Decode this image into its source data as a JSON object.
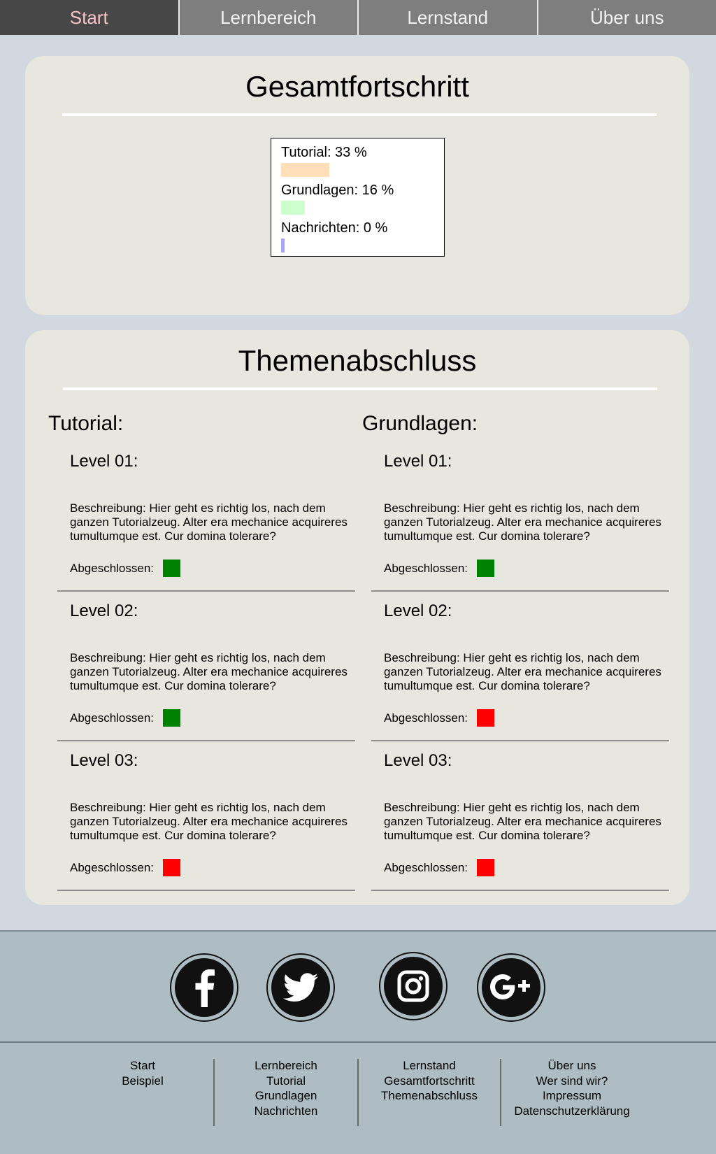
{
  "nav": [
    {
      "label": "Start",
      "active": true
    },
    {
      "label": "Lernbereich",
      "active": false
    },
    {
      "label": "Lernstand",
      "active": false
    },
    {
      "label": "Über uns",
      "active": false
    }
  ],
  "overall": {
    "title": "Gesamtfortschritt",
    "items": [
      {
        "label": "Tutorial: 33 %",
        "percent": 33,
        "color": "#ffdfb8"
      },
      {
        "label": "Grundlagen: 16 %",
        "percent": 16,
        "color": "#ccffcc"
      },
      {
        "label": "Nachrichten: 0 %",
        "percent": 0,
        "color": "#a8a8ee"
      }
    ]
  },
  "topics": {
    "title": "Themenabschluss",
    "columns": [
      {
        "title": "Tutorial:",
        "levels": [
          {
            "title": "Level 01:",
            "desc": "Beschreibung: Hier geht es richtig los, nach dem ganzen Tutorialzeug. Alter era mechanice acquireres tumultumque est. Cur domina tolerare?",
            "done_label": "Abgeschlossen:",
            "done": true
          },
          {
            "title": "Level 02:",
            "desc": "Beschreibung: Hier geht es richtig los, nach dem ganzen Tutorialzeug. Alter era mechanice acquireres tumultumque est. Cur domina tolerare?",
            "done_label": "Abgeschlossen:",
            "done": true
          },
          {
            "title": "Level 03:",
            "desc": "Beschreibung: Hier geht es richtig los, nach dem ganzen Tutorialzeug. Alter era mechanice acquireres tumultumque est. Cur domina tolerare?",
            "done_label": "Abgeschlossen:",
            "done": false
          }
        ]
      },
      {
        "title": "Grundlagen:",
        "levels": [
          {
            "title": "Level 01:",
            "desc": "Beschreibung: Hier geht es richtig los, nach dem ganzen Tutorialzeug. Alter era mechanice acquireres tumultumque est. Cur domina tolerare?",
            "done_label": "Abgeschlossen:",
            "done": true
          },
          {
            "title": "Level 02:",
            "desc": "Beschreibung: Hier geht es richtig los, nach dem ganzen Tutorialzeug. Alter era mechanice acquireres tumultumque est. Cur domina tolerare?",
            "done_label": "Abgeschlossen:",
            "done": false
          },
          {
            "title": "Level 03:",
            "desc": "Beschreibung: Hier geht es richtig los, nach dem ganzen Tutorialzeug. Alter era mechanice acquireres tumultumque est. Cur domina tolerare?",
            "done_label": "Abgeschlossen:",
            "done": false
          }
        ]
      }
    ],
    "done_color": "#008000",
    "open_color": "#ff0000"
  },
  "social": [
    {
      "name": "facebook-icon"
    },
    {
      "name": "twitter-icon"
    },
    {
      "name": "instagram-icon"
    },
    {
      "name": "google-plus-icon"
    }
  ],
  "footer": [
    {
      "links": [
        "Start",
        "Beispiel"
      ]
    },
    {
      "links": [
        "Lernbereich",
        "Tutorial",
        "Grundlagen",
        "Nachrichten"
      ]
    },
    {
      "links": [
        "Lernstand",
        "Gesamtfortschritt",
        "Themenabschluss"
      ]
    },
    {
      "links": [
        "Über uns",
        "Wer sind wir?",
        "Impressum",
        "Datenschutzerklärung"
      ]
    }
  ]
}
